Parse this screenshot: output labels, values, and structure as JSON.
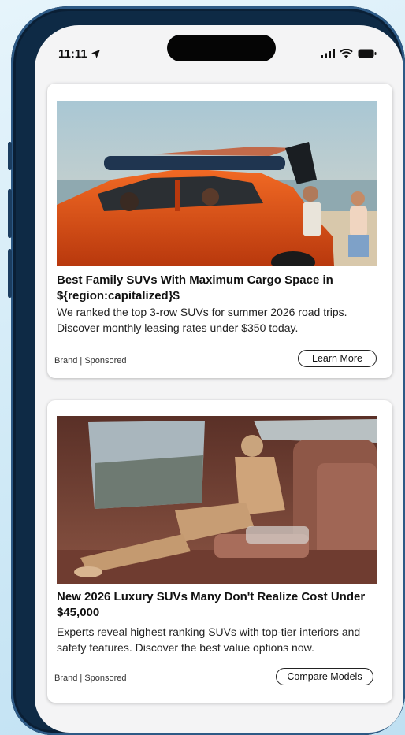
{
  "status_bar": {
    "time": "11:11",
    "icons": [
      "location-arrow-icon",
      "signal-icon",
      "wifi-icon",
      "battery-icon"
    ]
  },
  "ads": [
    {
      "image": "orange-suv-beach-family",
      "headline": "Best Family SUVs With Maximum Cargo Space in ${region:capitalized}$",
      "description": "We ranked the top 3-row SUVs for summer 2026 road trips. Discover monthly leasing rates under $350 today.",
      "brand": "Brand | Sponsored",
      "cta": "Learn More"
    },
    {
      "image": "luxury-suv-interior-woman",
      "headline": "New 2026 Luxury SUVs Many Don't Realize Cost Under $45,000",
      "description": "Experts reveal highest ranking SUVs with top-tier interiors and safety features. Discover the best value options now.",
      "brand": "Brand | Sponsored",
      "cta": "Compare Models"
    }
  ],
  "colors": {
    "phone_frame": "#0e2a45",
    "background": "#cfe9f6",
    "car_orange": "#e8541a",
    "leather": "#7a4435"
  }
}
